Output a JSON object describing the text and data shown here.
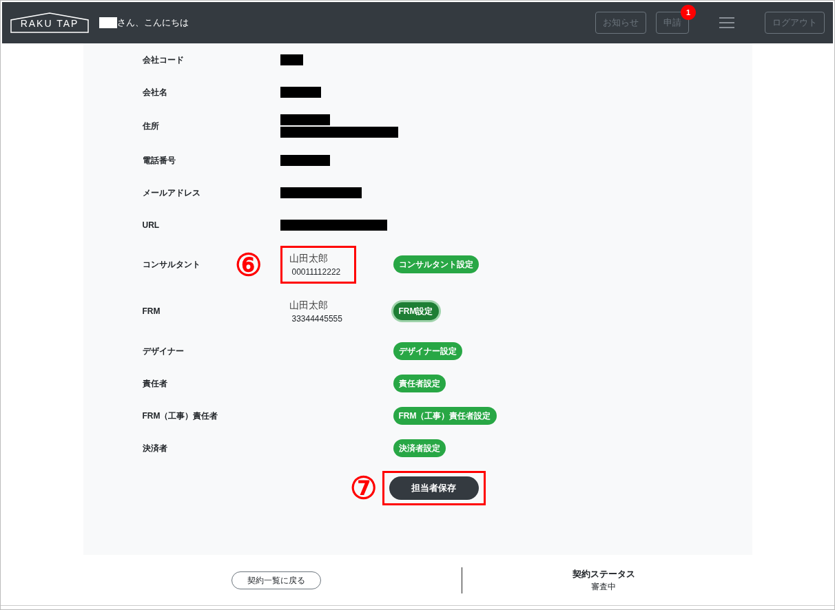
{
  "header": {
    "logo": "RAKU TAP",
    "greeting": "さん、こんにちは",
    "buttons": [
      {
        "label": "お知らせ"
      },
      {
        "label": "申請",
        "badge": "1"
      }
    ],
    "logout": "ログアウト"
  },
  "fields": [
    {
      "label": "会社コード",
      "kind": "redacted"
    },
    {
      "label": "会社名",
      "kind": "redacted"
    },
    {
      "label": "住所",
      "kind": "redacted_multiline"
    },
    {
      "label": "電話番号",
      "kind": "redacted"
    },
    {
      "label": "メールアドレス",
      "kind": "redacted"
    },
    {
      "label": "URL",
      "kind": "redacted"
    },
    {
      "label": "コンサルタント",
      "kind": "person",
      "name": "山田太郎",
      "code": "00011112222",
      "button": "コンサルタント設定",
      "focused": false,
      "annotation": "⑥"
    },
    {
      "label": "FRM",
      "kind": "person",
      "name": "山田太郎",
      "code": "33344445555",
      "button": "FRM設定",
      "focused": true
    },
    {
      "label": "デザイナー",
      "kind": "empty",
      "button": "デザイナー設定",
      "focused": false
    },
    {
      "label": "責任者",
      "kind": "empty",
      "button": "責任者設定",
      "focused": false
    },
    {
      "label": "FRM（工事）責任者",
      "kind": "empty",
      "button": "FRM（工事）責任者設定",
      "focused": false
    },
    {
      "label": "決済者",
      "kind": "empty",
      "button": "決済者設定",
      "focused": false
    }
  ],
  "save": {
    "label": "担当者保存",
    "annotation": "⑦"
  },
  "footer": {
    "back": "契約一覧に戻る",
    "status_label": "契約ステータス",
    "status_value": "審査中"
  }
}
